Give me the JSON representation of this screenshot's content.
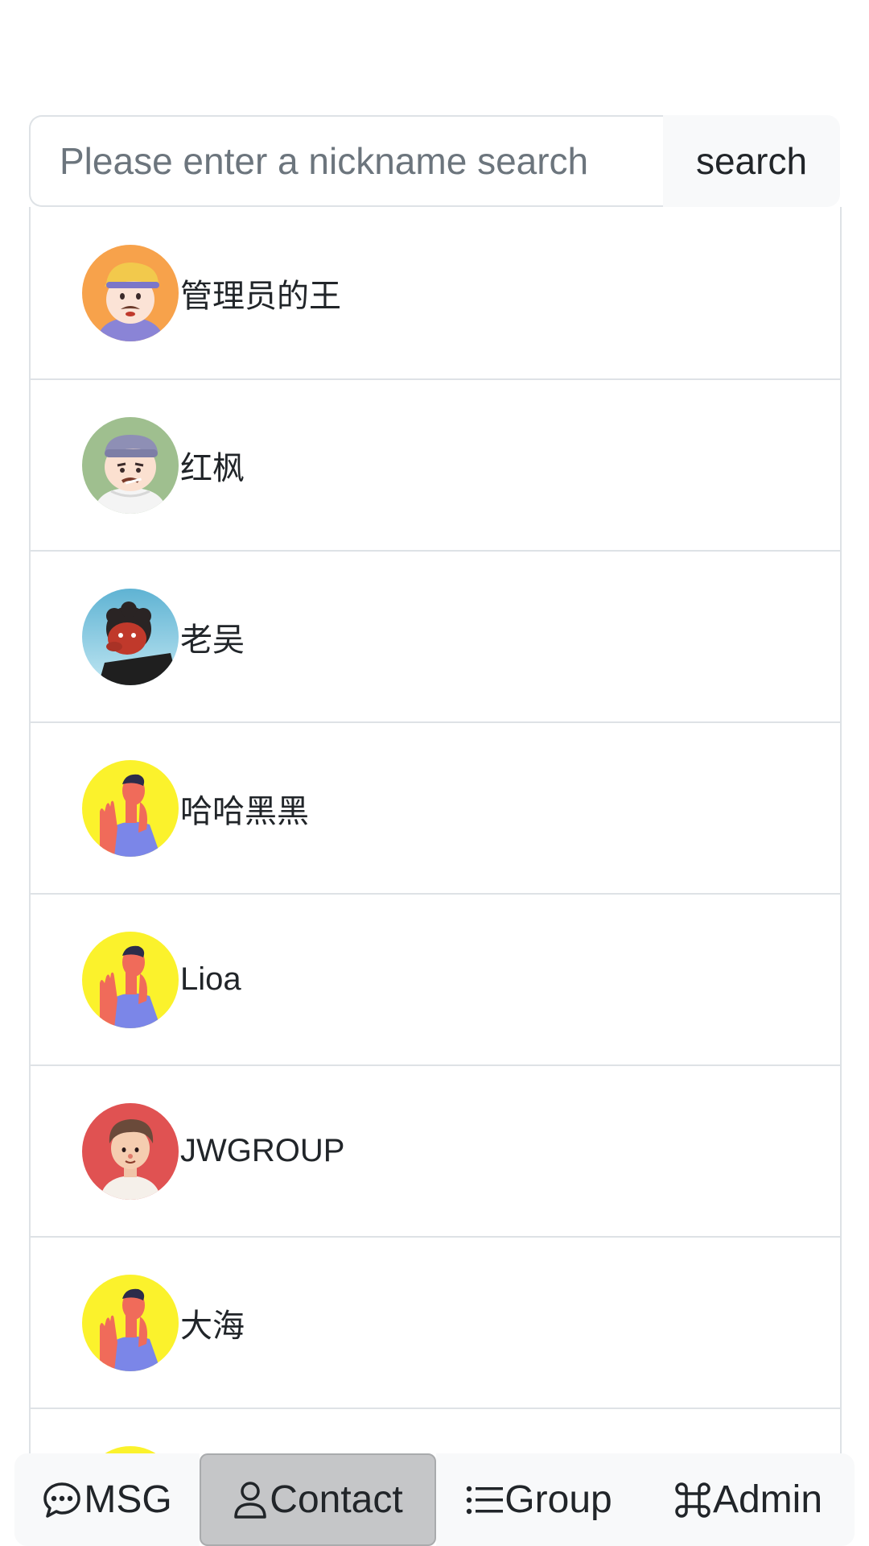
{
  "search": {
    "placeholder": "Please enter a nickname search",
    "value": "",
    "button_label": "search"
  },
  "contacts": [
    {
      "name": "管理员的王",
      "avatar": "cartoon-man-cap-orange"
    },
    {
      "name": "红枫",
      "avatar": "cartoon-man-beanie-green"
    },
    {
      "name": "老吴",
      "avatar": "red-face-curly-hair-blue"
    },
    {
      "name": "哈哈黑黑",
      "avatar": "man-hand-raised-yellow"
    },
    {
      "name": "Lioa",
      "avatar": "man-hand-raised-yellow"
    },
    {
      "name": "JWGROUP",
      "avatar": "boy-red"
    },
    {
      "name": "大海",
      "avatar": "man-hand-raised-yellow"
    },
    {
      "name": "",
      "avatar": "man-hand-raised-yellow"
    }
  ],
  "nav": {
    "items": [
      {
        "label": "MSG",
        "icon": "chat-dots-icon",
        "active": false
      },
      {
        "label": "Contact",
        "icon": "person-icon",
        "active": true
      },
      {
        "label": "Group",
        "icon": "list-icon",
        "active": false
      },
      {
        "label": "Admin",
        "icon": "command-icon",
        "active": false
      }
    ]
  },
  "colors": {
    "border": "#dee2e6",
    "nav_background": "#f8f9fa",
    "nav_active": "#c5c6c8",
    "text": "#212529",
    "placeholder": "#6c757d"
  }
}
